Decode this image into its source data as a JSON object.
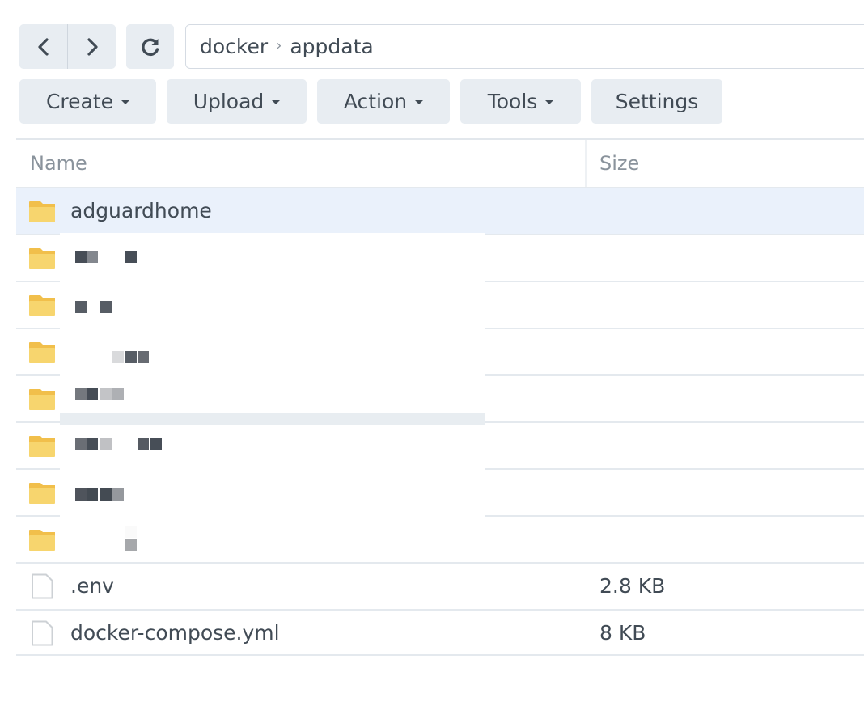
{
  "navigation": {
    "back_icon": "chevron-left-icon",
    "forward_icon": "chevron-right-icon",
    "refresh_icon": "refresh-icon"
  },
  "path": {
    "segments": [
      "docker",
      "appdata"
    ],
    "separator": "›"
  },
  "toolbar": {
    "buttons": [
      {
        "label": "Create",
        "dropdown": true
      },
      {
        "label": "Upload",
        "dropdown": true
      },
      {
        "label": "Action",
        "dropdown": true
      },
      {
        "label": "Tools",
        "dropdown": true
      },
      {
        "label": "Settings",
        "dropdown": false
      }
    ]
  },
  "table": {
    "columns": [
      "Name",
      "Size"
    ],
    "rows": [
      {
        "type": "folder",
        "name": "adguardhome",
        "size": "",
        "selected": true
      },
      {
        "type": "folder",
        "name": "[redacted]",
        "size": "",
        "redacted": true
      },
      {
        "type": "folder",
        "name": "[redacted]",
        "size": "",
        "redacted": true
      },
      {
        "type": "folder",
        "name": "[redacted]",
        "size": "",
        "redacted": true
      },
      {
        "type": "folder",
        "name": "[redacted]",
        "size": "",
        "redacted": true
      },
      {
        "type": "folder",
        "name": "[redacted]",
        "size": "",
        "redacted": true
      },
      {
        "type": "folder",
        "name": "[redacted]",
        "size": "",
        "redacted": true
      },
      {
        "type": "folder",
        "name": "[redacted]",
        "size": "",
        "redacted": true
      },
      {
        "type": "file",
        "name": ".env",
        "size": "2.8 KB"
      },
      {
        "type": "file",
        "name": "docker-compose.yml",
        "size": "8 KB"
      }
    ]
  },
  "colors": {
    "button_bg": "#e8edf2",
    "selected_row_bg": "#eaf1fb",
    "text": "#414b55",
    "muted_text": "#8a939c",
    "folder_body": "#f7d56e",
    "folder_tab": "#f1bf4b",
    "border": "#e4e9ee"
  }
}
